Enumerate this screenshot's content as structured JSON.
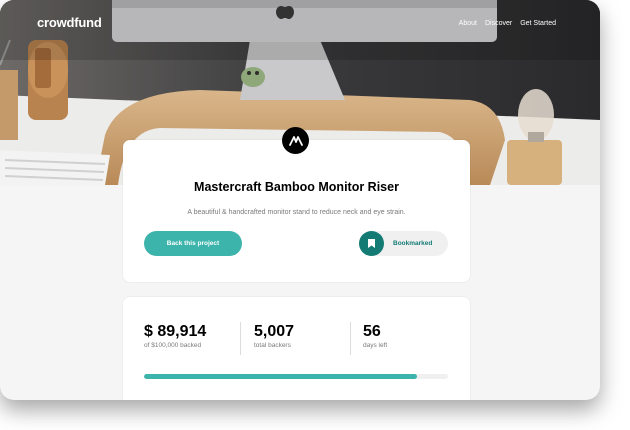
{
  "brand": {
    "logo": "crowdfund"
  },
  "nav": {
    "items": [
      "About",
      "Discover",
      "Get Started"
    ]
  },
  "project": {
    "title": "Mastercraft Bamboo Monitor Riser",
    "description": "A beautiful & handcrafted monitor stand to reduce neck and eye strain.",
    "back_label": "Back this project",
    "bookmark_label": "Bookmarked",
    "logo_icon": "mastercraft-logo-icon",
    "bookmark_icon": "bookmark-icon"
  },
  "stats": {
    "backed": {
      "value": "$ 89,914",
      "label": "of $100,000 backed"
    },
    "backers": {
      "value": "5,007",
      "label": "total backers"
    },
    "days": {
      "value": "56",
      "label": "days left"
    },
    "progress_fraction": 0.899
  },
  "colors": {
    "accent": "#3cb4ac",
    "accent_dark": "#147b74",
    "text": "#000000",
    "muted": "#7a7a7a"
  }
}
